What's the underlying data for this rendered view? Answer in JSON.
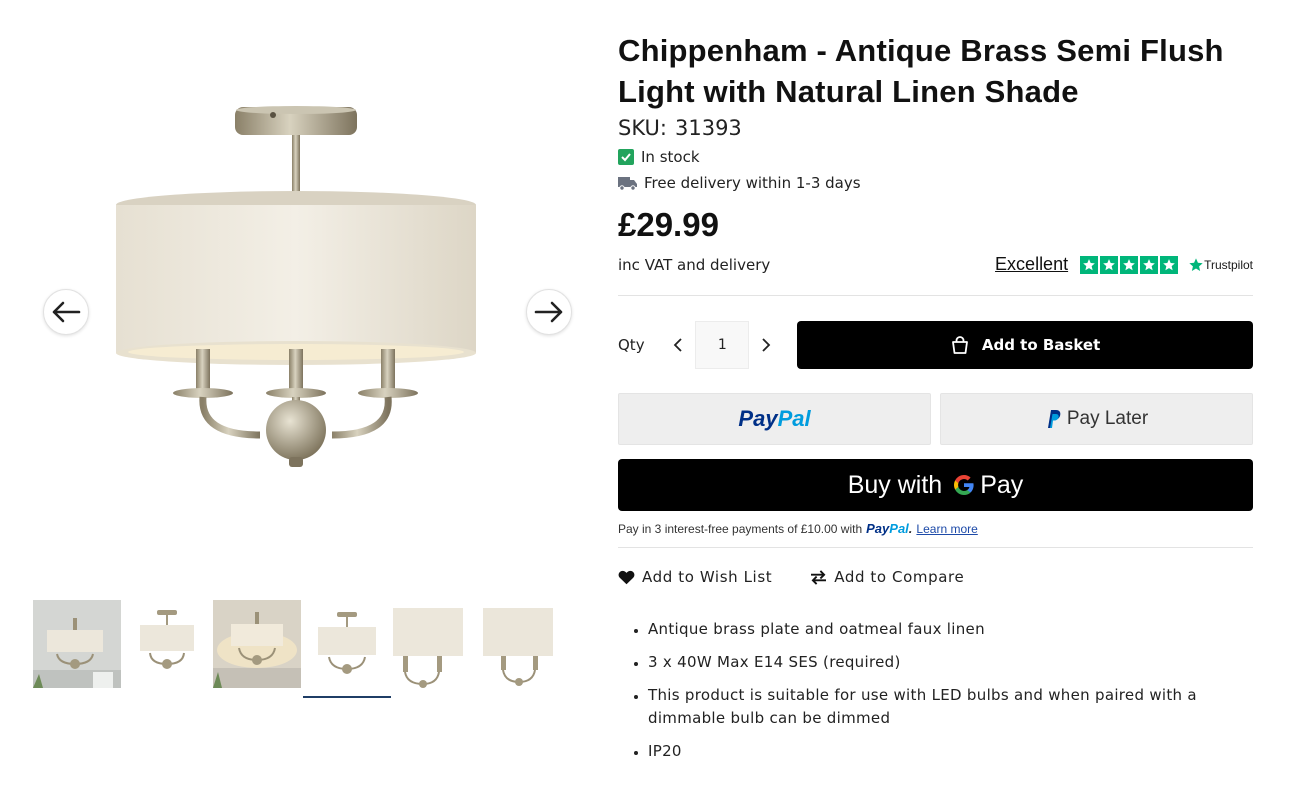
{
  "product": {
    "title": "Chippenham - Antique Brass Semi Flush Light with Natural Linen Shade",
    "sku_label": "SKU:",
    "sku": "31393",
    "stock": "In stock",
    "delivery": "Free delivery within 1-3 days",
    "price": "£29.99",
    "vat_note": "inc VAT and delivery"
  },
  "trustpilot": {
    "rating_word": "Excellent",
    "stars": 5,
    "brand": "Trustpilot",
    "color": "#00b67a"
  },
  "purchase": {
    "qty_label": "Qty",
    "qty_value": "1",
    "add_to_basket": "Add to Basket"
  },
  "payments": {
    "paypal_pay": "Pay",
    "paypal_pal": "Pal",
    "pay_later": "Pay Later",
    "gpay_buy_with": "Buy with",
    "gpay_pay": "Pay",
    "installments_text": "Pay in 3 interest-free payments of £10.00 with",
    "installments_learn_more": "Learn more"
  },
  "actions": {
    "wishlist": "Add to Wish List",
    "compare": "Add to Compare"
  },
  "features": [
    "Antique brass plate and oatmeal faux linen",
    "3 x 40W Max E14 SES (required)",
    "This product is suitable for use with LED bulbs and when paired with a dimmable bulb can be dimmed",
    "IP20"
  ],
  "gallery": {
    "thumbnail_count": 6,
    "active_thumbnail": 4
  },
  "colors": {
    "in_stock_green": "#22a45d",
    "paypal_dark": "#003087",
    "paypal_light": "#009cde",
    "active_thumb_border": "#1f3d66"
  }
}
